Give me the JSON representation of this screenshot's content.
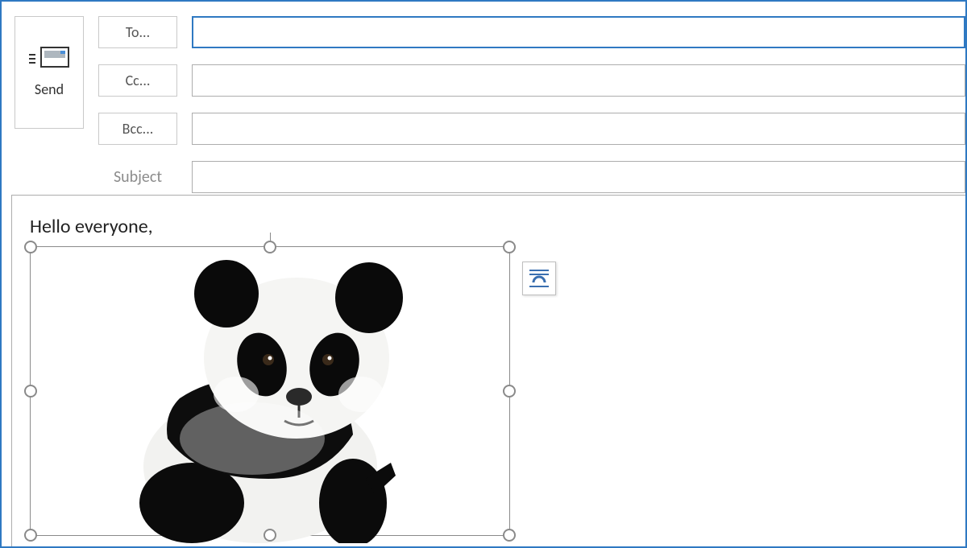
{
  "send": {
    "label": "Send"
  },
  "recipients": {
    "to": {
      "button_label": "To...",
      "value": ""
    },
    "cc": {
      "button_label": "Cc...",
      "value": ""
    },
    "bcc": {
      "button_label": "Bcc...",
      "value": ""
    }
  },
  "subject": {
    "label": "Subject",
    "value": ""
  },
  "body": {
    "greeting": "Hello everyone,",
    "image": {
      "description": "panda",
      "selected": true
    }
  },
  "layout_options_button": {
    "title": "Layout Options"
  }
}
